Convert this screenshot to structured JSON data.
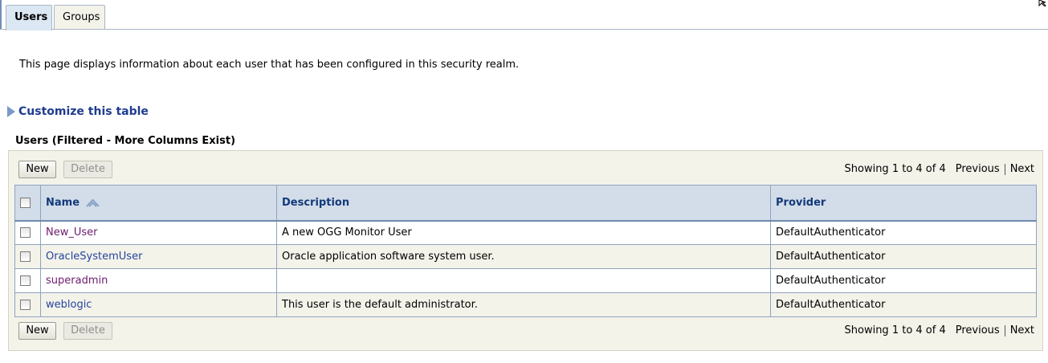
{
  "tabs": [
    {
      "label": "Users",
      "active": true
    },
    {
      "label": "Groups",
      "active": false
    }
  ],
  "description": "This page displays information about each user that has been configured in this security realm.",
  "customize_label": "Customize this table",
  "table_title": "Users (Filtered - More Columns Exist)",
  "toolbar": {
    "new_label": "New",
    "delete_label": "Delete",
    "showing": "Showing 1 to 4 of 4",
    "previous": "Previous",
    "next": "Next"
  },
  "columns": {
    "name": "Name",
    "description": "Description",
    "provider": "Provider"
  },
  "rows": [
    {
      "name": "New_User",
      "description": "A new OGG Monitor User",
      "provider": "DefaultAuthenticator"
    },
    {
      "name": "OracleSystemUser",
      "description": "Oracle application software system user.",
      "provider": "DefaultAuthenticator"
    },
    {
      "name": "superadmin",
      "description": "",
      "provider": "DefaultAuthenticator"
    },
    {
      "name": "weblogic",
      "description": "This user is the default administrator.",
      "provider": "DefaultAuthenticator"
    }
  ],
  "colors": {
    "link": "#2544a0",
    "visited_link": "#6e1c6e",
    "header_bg": "#d2dde9",
    "panel_bg": "#f4f3ea"
  },
  "icons": {
    "customize": "triangle-right-icon",
    "sort": "sort-ascending-icon",
    "checkbox": "checkbox-icon"
  }
}
